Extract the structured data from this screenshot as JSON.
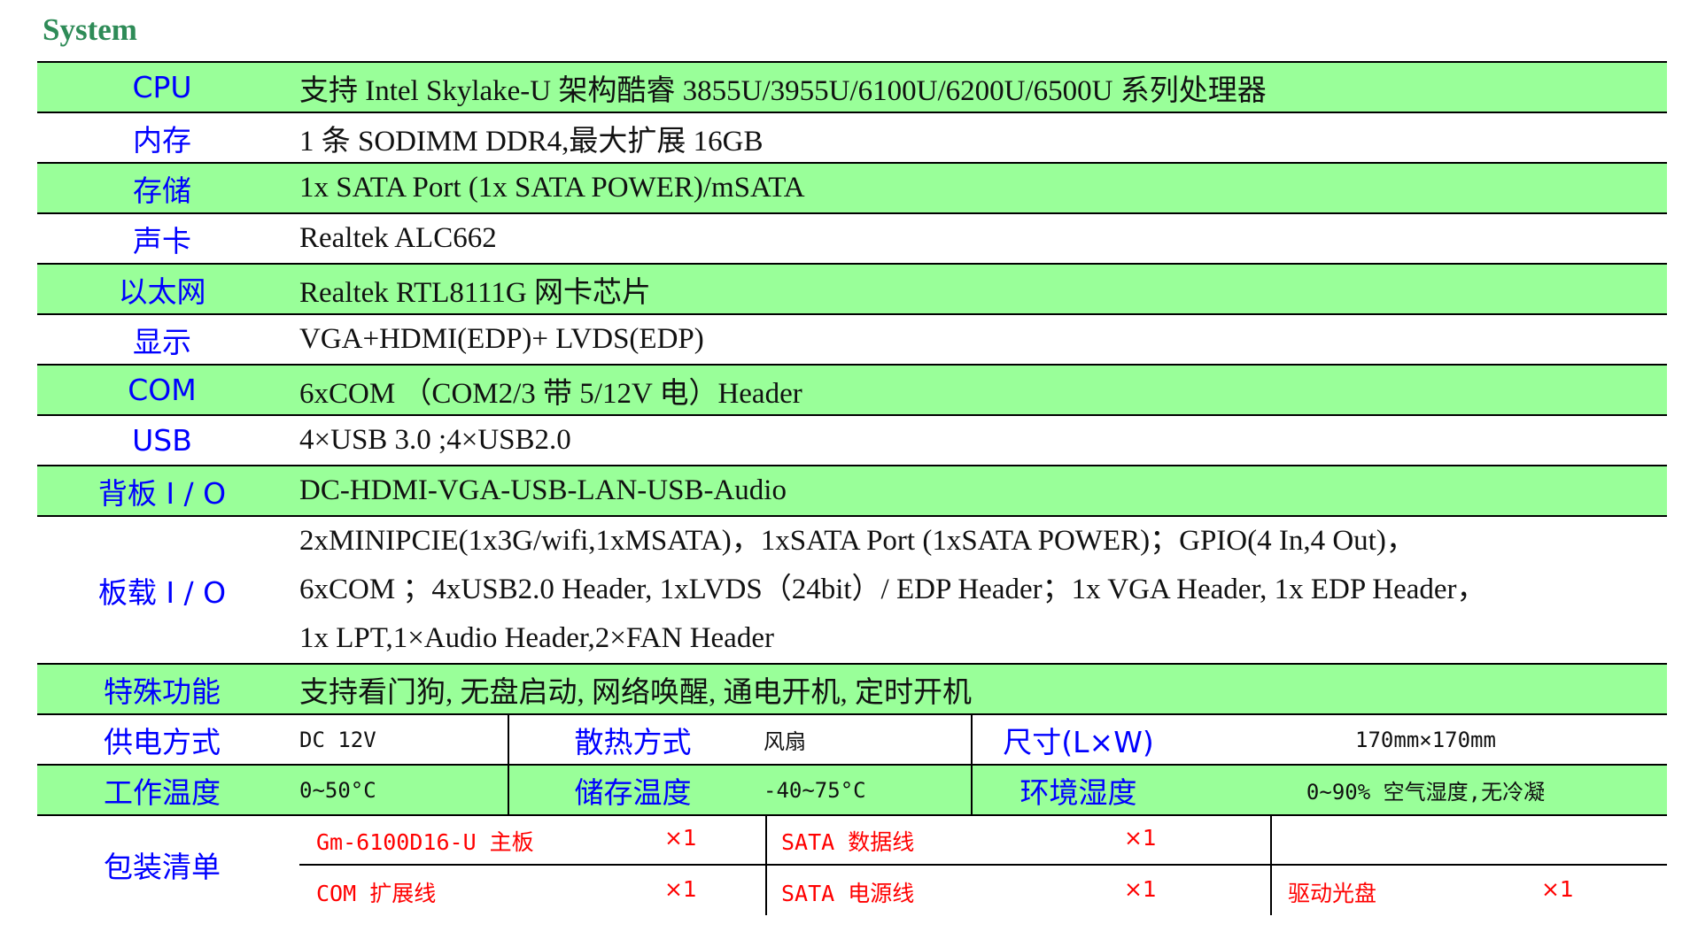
{
  "section_title": "System",
  "rows": [
    {
      "label": "CPU",
      "value": "支持 Intel Skylake-U 架构酷睿 3855U/3955U/6100U/6200U/6500U 系列处理器"
    },
    {
      "label": "内存",
      "value": "1 条 SODIMM DDR4,最大扩展 16GB"
    },
    {
      "label": "存储",
      "value": "1x SATA Port (1x SATA POWER)/mSATA"
    },
    {
      "label": "声卡",
      "value": "Realtek ALC662"
    },
    {
      "label": "以太网",
      "value": "Realtek RTL8111G 网卡芯片"
    },
    {
      "label": "显示",
      "value": "VGA+HDMI(EDP)+ LVDS(EDP)"
    },
    {
      "label": "COM",
      "value": "6xCOM （COM2/3 带 5/12V 电）Header"
    },
    {
      "label": "USB",
      "value": "4×USB 3.0 ;4×USB2.0"
    },
    {
      "label": "背板 I / O",
      "value": "DC-HDMI-VGA-USB-LAN-USB-Audio"
    }
  ],
  "onboard_io": {
    "label": "板载 I / O",
    "lines": [
      "2xMINIPCIE(1x3G/wifi,1xMSATA)，1xSATA Port (1xSATA POWER)；GPIO(4 In,4 Out)，",
      "6xCOM ；4xUSB2.0 Header, 1xLVDS（24bit）/ EDP Header；1x VGA Header, 1x EDP Header，",
      "1x LPT,1×Audio Header,2×FAN Header"
    ]
  },
  "special": {
    "label": "特殊功能",
    "value": "支持看门狗, 无盘启动, 网络唤醒, 通电开机, 定时开机"
  },
  "power_row": {
    "power_label": "供电方式",
    "power_value": "DC 12V",
    "cooling_label": "散热方式",
    "cooling_value": "风扇",
    "size_label": "尺寸(L×W)",
    "size_value": "170mm×170mm"
  },
  "env_row": {
    "temp_label": "工作温度",
    "temp_value": "0~50°C",
    "storage_label": "储存温度",
    "storage_value": "-40~75°C",
    "humidity_label": "环境湿度",
    "humidity_value": "0~90% 空气湿度,无冷凝"
  },
  "packing": {
    "label": "包装清单",
    "items": [
      {
        "name": "Gm-6100D16-U 主板",
        "qty": "×1"
      },
      {
        "name": "SATA 数据线",
        "qty": "×1"
      },
      {
        "name": "COM 扩展线",
        "qty": "×1"
      },
      {
        "name": "SATA 电源线",
        "qty": "×1"
      },
      {
        "name": "驱动光盘",
        "qty": "×1"
      }
    ]
  },
  "colors": {
    "label_blue": "#0000ff",
    "row_green": "#99ff99",
    "heading_green": "#2e8b57",
    "packing_red": "#ff0000"
  }
}
